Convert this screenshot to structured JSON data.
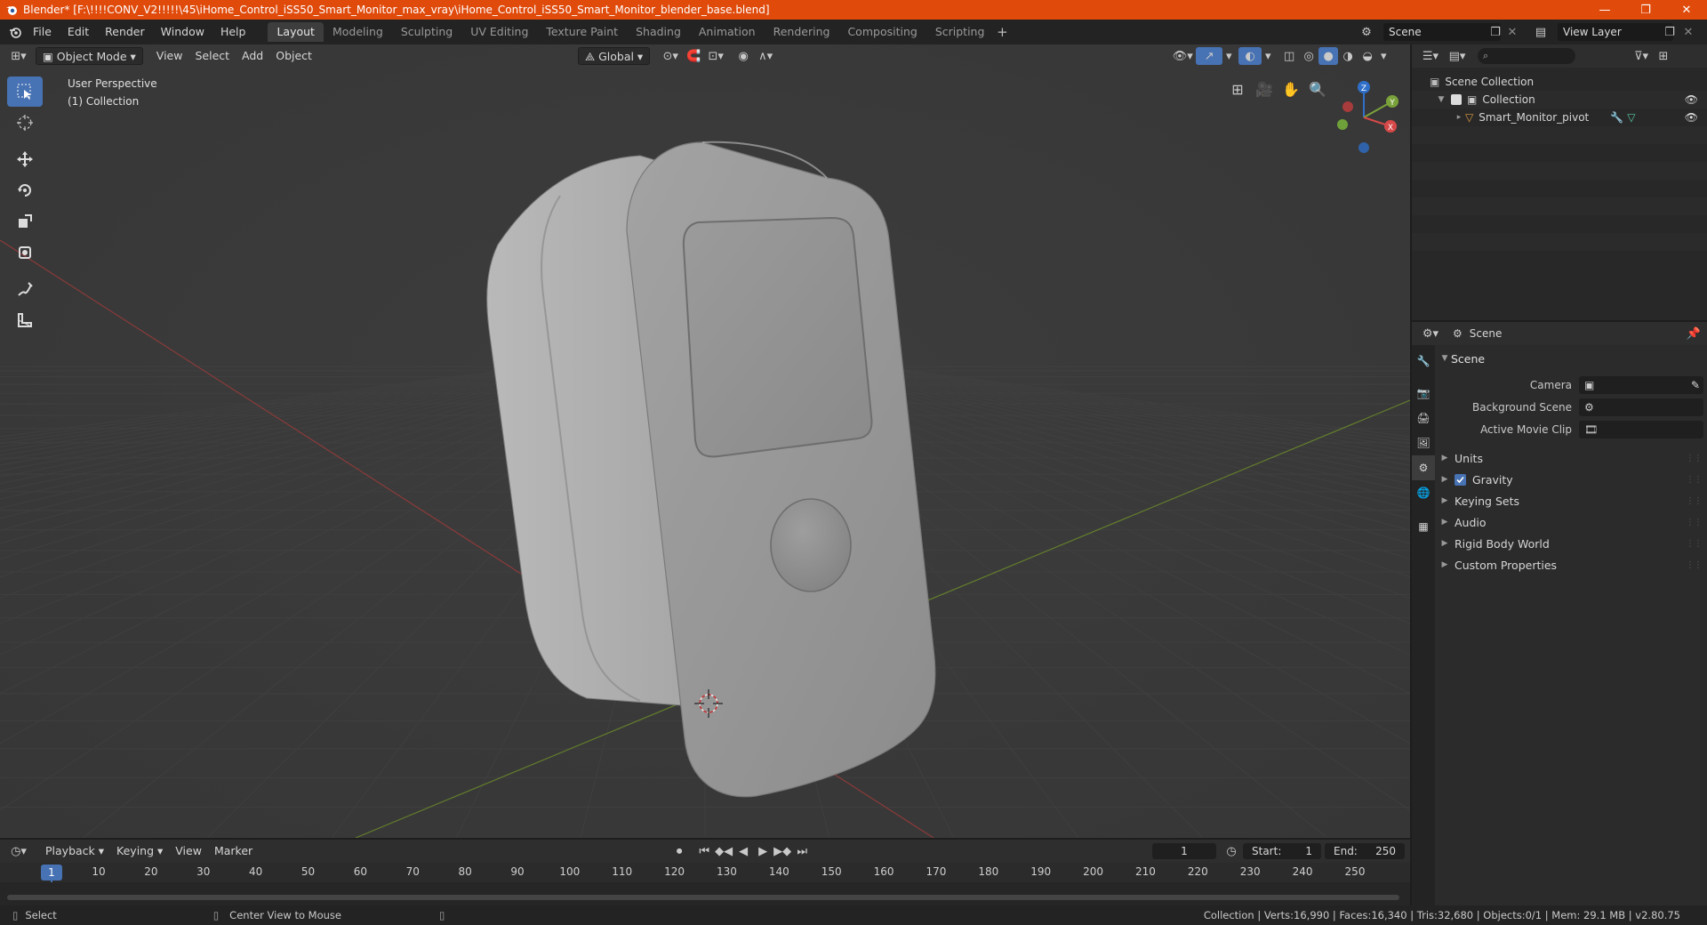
{
  "titlebar": {
    "title": "Blender* [F:\\!!!!CONV_V2!!!!!\\45\\iHome_Control_iSS50_Smart_Monitor_max_vray\\iHome_Control_iSS50_Smart_Monitor_blender_base.blend]",
    "minimize": "—",
    "maximize": "❐",
    "close": "✕"
  },
  "menu": {
    "items": [
      "File",
      "Edit",
      "Render",
      "Window",
      "Help"
    ]
  },
  "workspaces": {
    "tabs": [
      "Layout",
      "Modeling",
      "Sculpting",
      "UV Editing",
      "Texture Paint",
      "Shading",
      "Animation",
      "Rendering",
      "Compositing",
      "Scripting"
    ],
    "active": "Layout",
    "add": "+"
  },
  "topright": {
    "scene": "Scene",
    "view_layer": "View Layer"
  },
  "viewport": {
    "mode": "Object Mode",
    "menus": [
      "View",
      "Select",
      "Add",
      "Object"
    ],
    "orientation": "Global",
    "info_line1": "User Perspective",
    "info_line2": "(1) Collection"
  },
  "gizmo": {
    "z": "Z",
    "y": "Y",
    "x": "X"
  },
  "outliner": {
    "search_placeholder": "",
    "root": "Scene Collection",
    "collection": "Collection",
    "object": "Smart_Monitor_pivot"
  },
  "properties": {
    "context": "Scene",
    "panel": "Scene",
    "fields": [
      {
        "label": "Camera"
      },
      {
        "label": "Background Scene"
      },
      {
        "label": "Active Movie Clip"
      }
    ],
    "subpanels": [
      "Units",
      "Gravity",
      "Keying Sets",
      "Audio",
      "Rigid Body World",
      "Custom Properties"
    ]
  },
  "timeline": {
    "menus": [
      "Playback",
      "Keying",
      "View",
      "Marker"
    ],
    "current_frame": "1",
    "start_label": "Start:",
    "start": "1",
    "end_label": "End:",
    "end": "250",
    "ticks": [
      "1",
      "10",
      "20",
      "30",
      "40",
      "50",
      "60",
      "70",
      "80",
      "90",
      "100",
      "110",
      "120",
      "130",
      "140",
      "150",
      "160",
      "170",
      "180",
      "190",
      "200",
      "210",
      "220",
      "230",
      "240",
      "250"
    ]
  },
  "statusbar": {
    "select": "Select",
    "center_view": "Center View to Mouse",
    "stats": "Collection | Verts:16,990 | Faces:16,340 | Tris:32,680 | Objects:0/1 | Mem: 29.1 MB | v2.80.75"
  },
  "colors": {
    "titlebar": "#e04b0c",
    "accent": "#4772b3",
    "viewport_bg": "#393939"
  }
}
